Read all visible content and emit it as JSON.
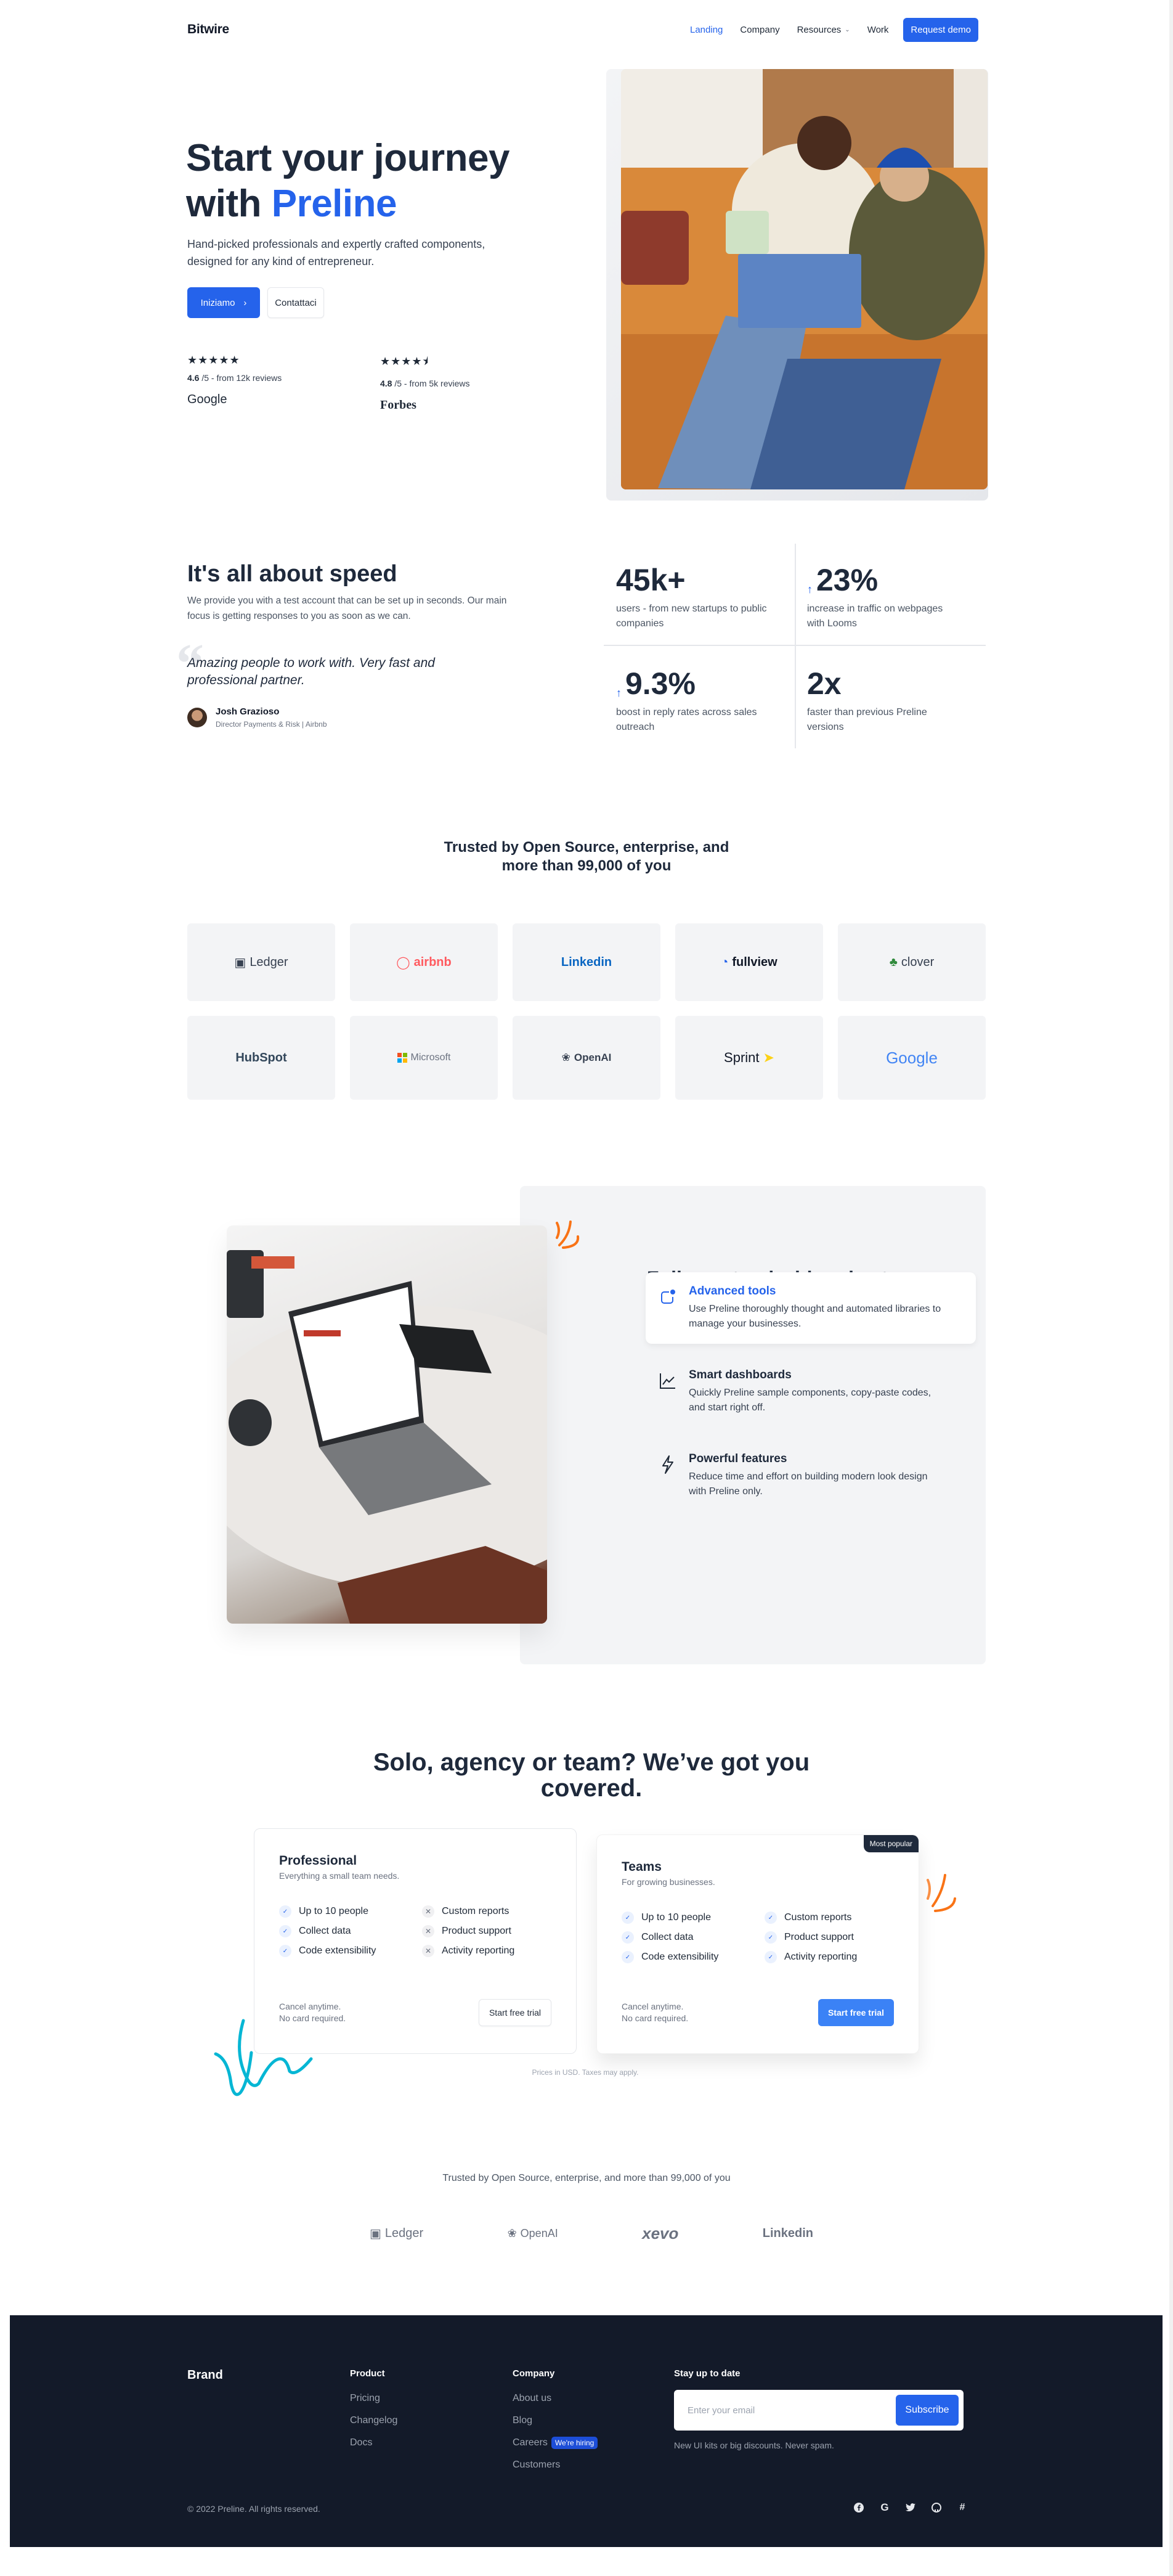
{
  "nav": {
    "brand": "Bitwire",
    "links": [
      {
        "label": "Landing",
        "active": true
      },
      {
        "label": "Company"
      },
      {
        "label": "Resources",
        "dropdown": true
      },
      {
        "label": "Work"
      }
    ],
    "cta": "Request demo"
  },
  "hero": {
    "title_line1": "Start your journey",
    "title_prefix": "with",
    "title_accent": "Preline",
    "subtitle": "Hand-picked professionals and expertly crafted components, designed for any kind of entrepreneur.",
    "primary_button": "Iniziamo",
    "secondary_button": "Contattaci",
    "ratings": [
      {
        "stars": "★★★★★",
        "score": "4.6",
        "suffix": " /5 - from 12k reviews",
        "source": "Google"
      },
      {
        "stars": "★★★★⯨",
        "score": "4.8",
        "suffix": " /5 - from 5k reviews",
        "source": "Forbes"
      }
    ]
  },
  "speed": {
    "title": "It's all about speed",
    "text": "We provide you with a test account that can be set up in seconds. Our main focus is getting responses to you as soon as we can.",
    "quote_mark": "“",
    "quote": "Amazing people to work with. Very fast and professional partner.",
    "author": "Josh Grazioso",
    "author_role": "Director Payments & Risk | Airbnb",
    "stats": [
      {
        "value": "45k+",
        "arrow": false,
        "desc": "users - from new startups to public companies"
      },
      {
        "value": "23%",
        "arrow": true,
        "desc": "increase in traffic on webpages with Looms"
      },
      {
        "value": "9.3%",
        "arrow": true,
        "desc": "boost in reply rates across sales outreach"
      },
      {
        "value": "2x",
        "arrow": false,
        "desc": "faster than previous Preline versions"
      }
    ],
    "arrow_glyph": "↑"
  },
  "trusted": {
    "title": "Trusted by Open Source, enterprise, and more than 99,000 of you",
    "logos": [
      {
        "name": "Ledger",
        "color": "#374151"
      },
      {
        "name": "airbnb",
        "color": "#ff5a5f"
      },
      {
        "name": "Linkedin",
        "color": "#0a66c2"
      },
      {
        "name": "fullview",
        "color": "#111827"
      },
      {
        "name": "clover",
        "color": "#374151"
      },
      {
        "name": "HubSpot",
        "color": "#33475b"
      },
      {
        "name": "Microsoft",
        "color": "#6b7280"
      },
      {
        "name": "OpenAI",
        "color": "#374151"
      },
      {
        "name": "Sprint",
        "color": "#111827"
      },
      {
        "name": "Google",
        "color": "#4285f4"
      }
    ]
  },
  "features": {
    "title": "Fully customizable rules to match your unique needs",
    "items": [
      {
        "title": "Advanced tools",
        "desc": "Use Preline thoroughly thought and automated libraries to manage your businesses.",
        "icon": "notification-icon",
        "active": true
      },
      {
        "title": "Smart dashboards",
        "desc": "Quickly Preline sample components, copy-paste codes, and start right off.",
        "icon": "chart-line-icon"
      },
      {
        "title": "Powerful features",
        "desc": "Reduce time and effort on building modern look design with Preline only.",
        "icon": "lightning-icon"
      }
    ]
  },
  "pricing": {
    "title": "Solo, agency or team? We’ve got you covered.",
    "plans": [
      {
        "name": "Professional",
        "tagline": "Everything a small team needs.",
        "features": [
          {
            "label": "Up to 10 people",
            "included": true
          },
          {
            "label": "Custom reports",
            "included": false
          },
          {
            "label": "Collect data",
            "included": true
          },
          {
            "label": "Product support",
            "included": false
          },
          {
            "label": "Code extensibility",
            "included": true
          },
          {
            "label": "Activity reporting",
            "included": false
          }
        ],
        "note_line1": "Cancel anytime.",
        "note_line2": "No card required.",
        "button": "Start free trial"
      },
      {
        "name": "Teams",
        "tagline": "For growing businesses.",
        "badge": "Most popular",
        "features": [
          {
            "label": "Up to 10 people",
            "included": true
          },
          {
            "label": "Custom reports",
            "included": true
          },
          {
            "label": "Collect data",
            "included": true
          },
          {
            "label": "Product support",
            "included": true
          },
          {
            "label": "Code extensibility",
            "included": true
          },
          {
            "label": "Activity reporting",
            "included": true
          }
        ],
        "note_line1": "Cancel anytime.",
        "note_line2": "No card required.",
        "button": "Start free trial"
      }
    ],
    "footnote": "Prices in USD. Taxes may apply."
  },
  "trusted2": {
    "title": "Trusted by Open Source, enterprise, and more than 99,000 of you",
    "logos": [
      "Ledger",
      "OpenAI",
      "xevo",
      "Linkedin"
    ]
  },
  "footer": {
    "brand": "Brand",
    "columns": [
      {
        "heading": "Product",
        "links": [
          {
            "label": "Pricing"
          },
          {
            "label": "Changelog"
          },
          {
            "label": "Docs"
          }
        ]
      },
      {
        "heading": "Company",
        "links": [
          {
            "label": "About us"
          },
          {
            "label": "Blog"
          },
          {
            "label": "Careers",
            "badge": "We're hiring"
          },
          {
            "label": "Customers"
          }
        ]
      }
    ],
    "newsletter": {
      "heading": "Stay up to date",
      "placeholder": "Enter your email",
      "value": "",
      "button": "Subscribe",
      "fine_print": "New UI kits or big discounts. Never spam."
    },
    "copyright": "© 2022 Preline. All rights reserved.",
    "socials": [
      "facebook-icon",
      "google-icon",
      "twitter-icon",
      "github-icon",
      "slack-icon"
    ]
  },
  "colors": {
    "accent": "#2563eb",
    "heading": "#1e293b",
    "footer_bg": "#131a29",
    "muted_bg": "#f3f4f6",
    "squiggle_orange": "#f97316",
    "squiggle_cyan": "#06b6d4"
  }
}
